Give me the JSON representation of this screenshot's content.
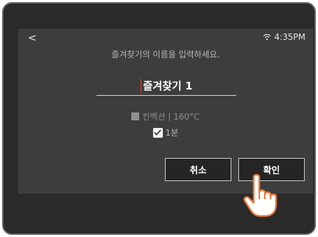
{
  "header": {
    "back_glyph": "<",
    "time": "4:35PM",
    "wifi_icon": "wifi-icon"
  },
  "dialog": {
    "prompt": "즐겨찾기의 이름을 입력하세요.",
    "name_value": "즐겨찾기 1",
    "mode": "컨벡션 | 160°C",
    "time_option": "1분"
  },
  "buttons": {
    "cancel": "취소",
    "confirm": "확인"
  },
  "colors": {
    "screen_bg": "#3d3d3d",
    "cursor": "#e2453a"
  }
}
